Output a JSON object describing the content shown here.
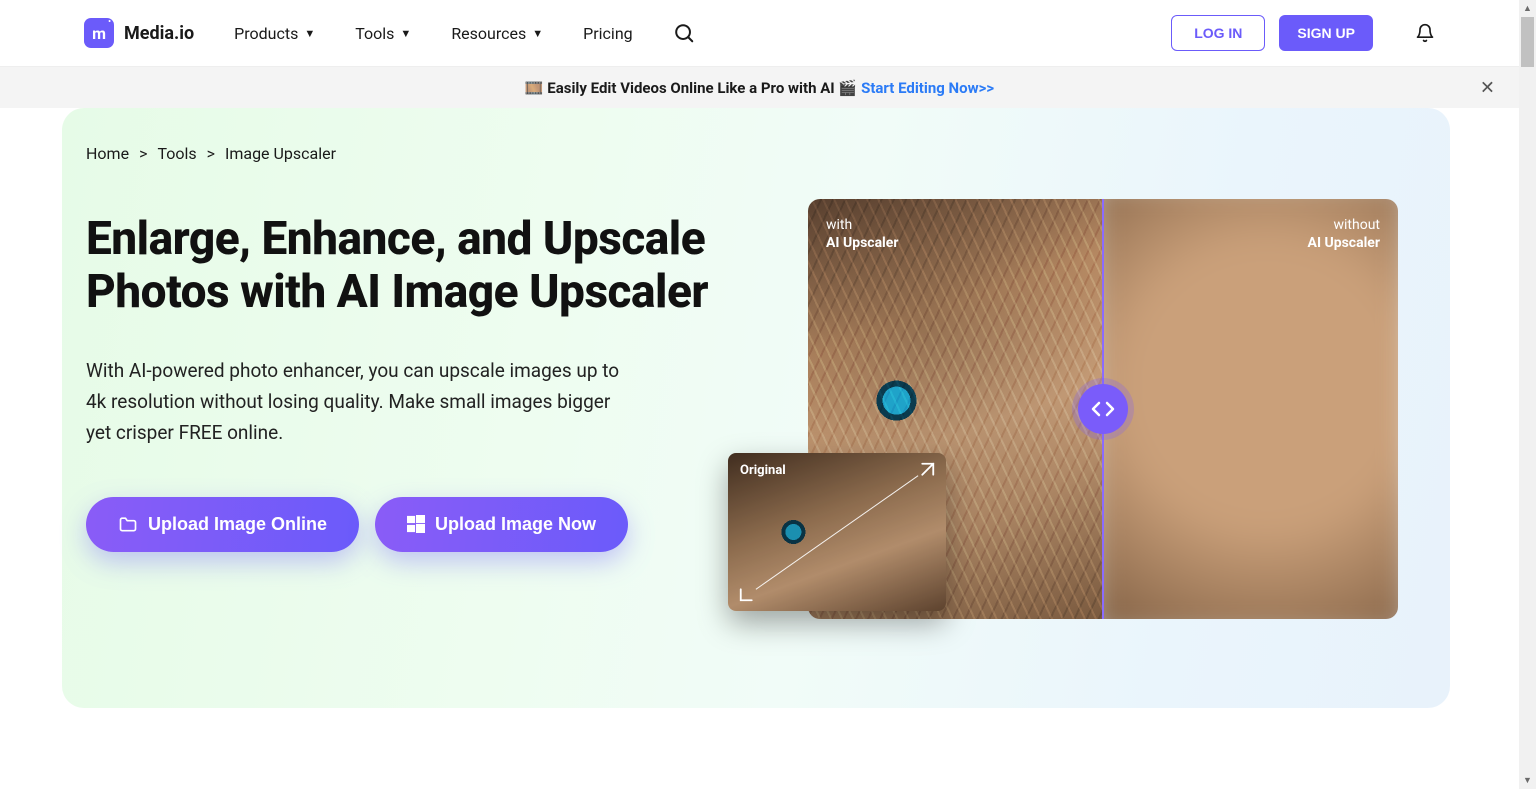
{
  "brand": {
    "name": "Media.io",
    "logo_letter": "m"
  },
  "nav": {
    "items": [
      {
        "label": "Products"
      },
      {
        "label": "Tools"
      },
      {
        "label": "Resources"
      },
      {
        "label": "Pricing"
      }
    ]
  },
  "auth": {
    "login": "LOG IN",
    "signup": "SIGN UP"
  },
  "banner": {
    "prefix_emoji": "🎞️",
    "text": "Easily Edit Videos Online Like a Pro with AI",
    "suffix_emoji": "🎬",
    "link_text": "Start Editing Now>>"
  },
  "breadcrumb": {
    "home": "Home",
    "tools": "Tools",
    "current": "Image Upscaler"
  },
  "hero": {
    "title": "Enlarge, Enhance, and Upscale Photos with AI Image Upscaler",
    "description": "With AI-powered photo enhancer, you can upscale images up to 4k resolution without losing quality. Make small images bigger yet crisper FREE online.",
    "cta_online": "Upload Image Online",
    "cta_now": "Upload Image Now"
  },
  "compare": {
    "with_line1": "with",
    "with_line2": "AI Upscaler",
    "without_line1": "without",
    "without_line2": "AI Upscaler",
    "inset_label": "Original"
  }
}
